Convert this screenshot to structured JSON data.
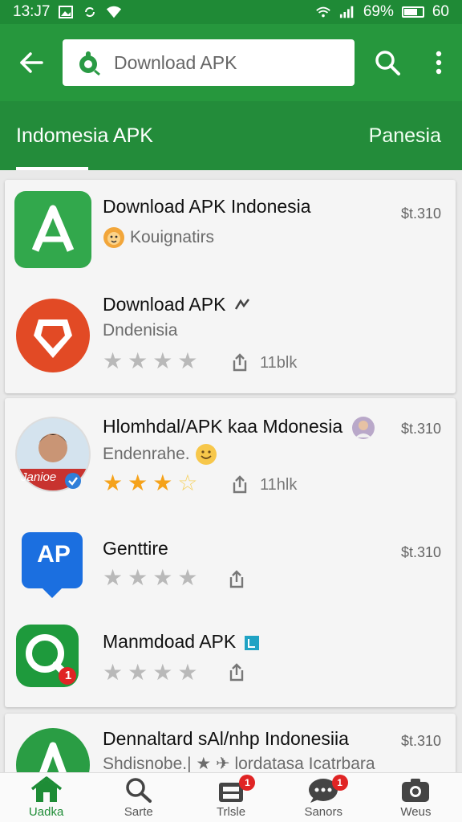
{
  "status_bar": {
    "time": "13:J7",
    "battery": "69%",
    "extra": "60"
  },
  "search": {
    "value": "Download APK"
  },
  "tabs": [
    {
      "label": "Indomesia APK",
      "active": true
    },
    {
      "label": "Panesia",
      "active": false
    }
  ],
  "apps": [
    {
      "title": "Download APK  Indonesia",
      "subtitle": "Kouignatirs",
      "price": "$t.310",
      "rating": null,
      "downloads": null,
      "icon": "green-a-icon"
    },
    {
      "title": "Download APK",
      "subtitle": "Dndenisia",
      "price": null,
      "rating": 0,
      "downloads": "11blk",
      "icon": "red-shield-icon"
    },
    {
      "title": "Hlomhdal/APK kaa  Mdonesia",
      "subtitle": "Endenrahe.",
      "price": "$t.310",
      "rating": 3.5,
      "downloads": "11hlk",
      "icon": "avatar-photo-icon",
      "icon_caption": "Janioe"
    },
    {
      "title": "Genttire",
      "subtitle": "",
      "price": "$t.310",
      "rating": 0,
      "downloads": null,
      "icon": "blue-ap-icon",
      "icon_text": "AP"
    },
    {
      "title": "Manmdoad APK",
      "subtitle": "",
      "price": null,
      "rating": 0,
      "downloads": null,
      "icon": "green-search-icon",
      "badge": "1"
    },
    {
      "title": "Dennaltard   sAl/nhp Indonesiia",
      "subtitle": "Shdisnobe.|  ★ ✈  lordatasa Icatrbara",
      "price": "$t.310",
      "rating": null,
      "downloads": null,
      "icon": "green-a-icon"
    }
  ],
  "bottom_nav": [
    {
      "label": "Uadka",
      "icon": "home-icon",
      "active": true,
      "badge": null
    },
    {
      "label": "Sarte",
      "icon": "search-icon",
      "active": false,
      "badge": null
    },
    {
      "label": "Trlsle",
      "icon": "inbox-icon",
      "active": false,
      "badge": "1"
    },
    {
      "label": "Sanors",
      "icon": "chat-icon",
      "active": false,
      "badge": "1"
    },
    {
      "label": "Weus",
      "icon": "camera-icon",
      "active": false,
      "badge": null
    }
  ],
  "colors": {
    "primary": "#26973d",
    "status_bar": "#1f8a36",
    "star": "#f5a21a"
  }
}
